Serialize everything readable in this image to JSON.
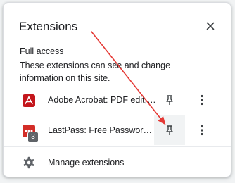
{
  "popup": {
    "title": "Extensions",
    "close_icon": "close-icon"
  },
  "full_access": {
    "heading": "Full access",
    "description": "These extensions can see and change information on this site."
  },
  "extensions": [
    {
      "name": "Adobe Acrobat: PDF edit, convert, sign tools",
      "icon": "adobe-acrobat-icon",
      "icon_color": "#c4161c",
      "pin_icon": "pin-icon",
      "more_icon": "more-vert-icon"
    },
    {
      "name": "LastPass: Free Password Manager",
      "icon": "lastpass-icon",
      "icon_color": "#d32d27",
      "badge": "3",
      "pin_icon": "pin-icon",
      "more_icon": "more-vert-icon"
    }
  ],
  "footer": {
    "manage_label": "Manage extensions",
    "manage_icon": "gear-icon"
  },
  "annotation": {
    "arrow_color": "#e53935"
  }
}
